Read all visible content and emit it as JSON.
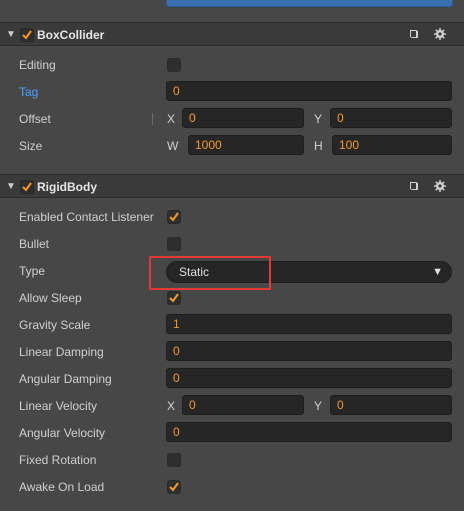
{
  "box_collider": {
    "title": "BoxCollider",
    "enabled": true,
    "icons": [
      "book-icon",
      "gear-icon"
    ],
    "rows": {
      "editing": {
        "label": "Editing",
        "checked": false
      },
      "tag": {
        "label": "Tag",
        "value": "0"
      },
      "offset": {
        "label": "Offset",
        "x_axis": "X",
        "x_value": "0",
        "y_axis": "Y",
        "y_value": "0"
      },
      "size": {
        "label": "Size",
        "w_axis": "W",
        "w_value": "1000",
        "h_axis": "H",
        "h_value": "100"
      }
    }
  },
  "rigid_body": {
    "title": "RigidBody",
    "enabled": true,
    "icons": [
      "book-icon",
      "gear-icon"
    ],
    "rows": {
      "enabled_contact_listener": {
        "label": "Enabled Contact Listener",
        "checked": true
      },
      "bullet": {
        "label": "Bullet",
        "checked": false
      },
      "type": {
        "label": "Type",
        "value": "Static"
      },
      "allow_sleep": {
        "label": "Allow Sleep",
        "checked": true
      },
      "gravity_scale": {
        "label": "Gravity Scale",
        "value": "1"
      },
      "linear_damping": {
        "label": "Linear Damping",
        "value": "0"
      },
      "angular_damping": {
        "label": "Angular Damping",
        "value": "0"
      },
      "linear_velocity": {
        "label": "Linear Velocity",
        "x_axis": "X",
        "x_value": "0",
        "y_axis": "Y",
        "y_value": "0"
      },
      "angular_velocity": {
        "label": "Angular Velocity",
        "value": "0"
      },
      "fixed_rotation": {
        "label": "Fixed Rotation",
        "checked": false
      },
      "awake_on_load": {
        "label": "Awake On Load",
        "checked": true
      }
    }
  },
  "colors": {
    "accent": "#f39a2e",
    "highlight": "#e53935",
    "tag_label": "#4aa3ff",
    "panel_bg": "#474747"
  }
}
